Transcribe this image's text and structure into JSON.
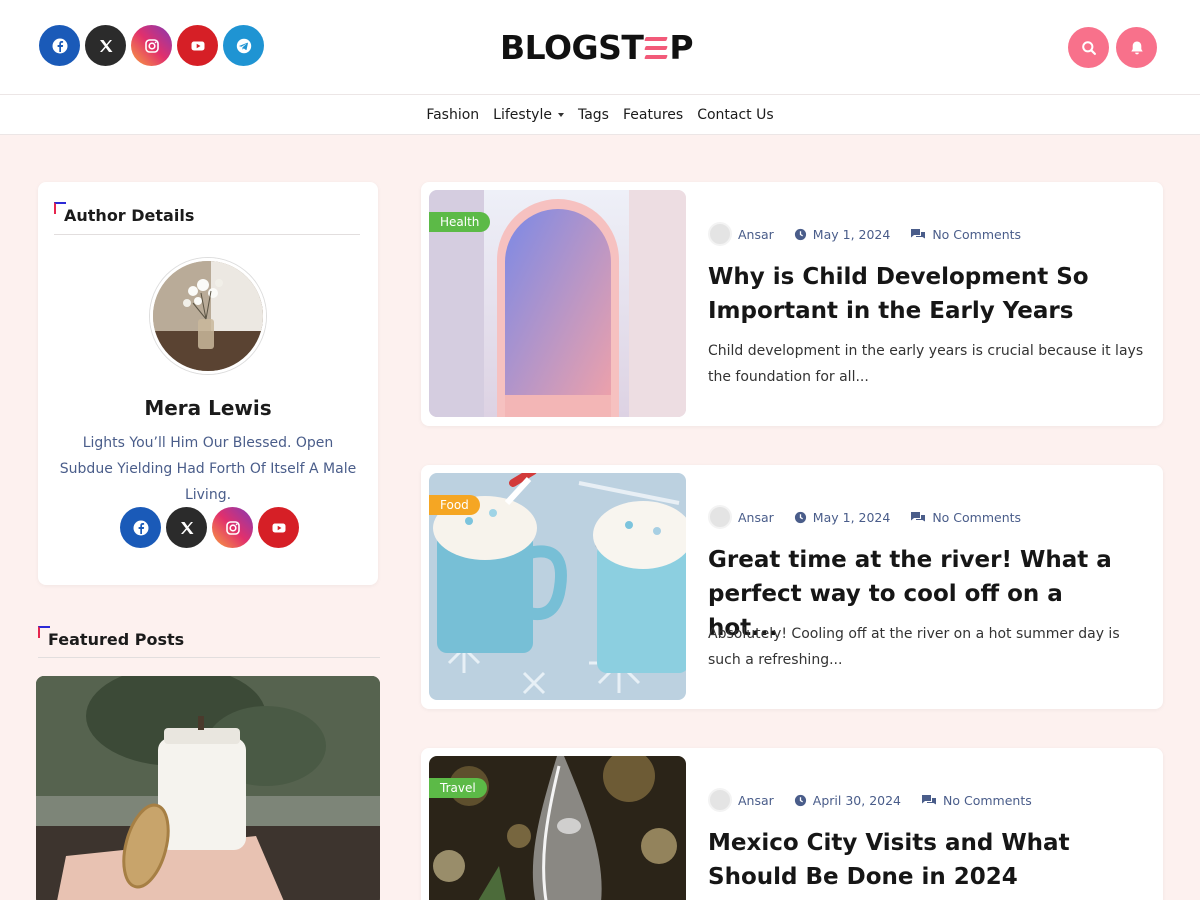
{
  "header": {
    "logo_text": "BLOGST",
    "logo_end": "P",
    "social": [
      {
        "icon": "facebook-icon",
        "color": "#1877f2"
      },
      {
        "icon": "x-icon",
        "color": "#222222"
      },
      {
        "icon": "instagram-icon",
        "color": "#d6249f"
      },
      {
        "icon": "youtube-icon",
        "color": "#e62117"
      },
      {
        "icon": "telegram-icon",
        "color": "#229ed9"
      }
    ],
    "accent": "#f8718b"
  },
  "nav": {
    "items": [
      {
        "label": "Fashion"
      },
      {
        "label": "Lifestyle",
        "dropdown": true
      },
      {
        "label": "Tags"
      },
      {
        "label": "Features"
      },
      {
        "label": "Contact Us"
      }
    ]
  },
  "sidebar": {
    "author_widget_title": "Author Details",
    "author_name": "Mera Lewis",
    "author_bio": "Lights You’ll Him Our Blessed. Open Subdue Yielding Had Forth Of Itself A Male Living.",
    "featured_title": "Featured Posts"
  },
  "posts": [
    {
      "category": "Health",
      "category_color": "#5cba47",
      "author": "Ansar",
      "date": "May 1, 2024",
      "comments": "No Comments",
      "title": "Why is Child Development So Important in the Early Years",
      "excerpt": "Child development in the early years is crucial because it lays the foundation for all..."
    },
    {
      "category": "Food",
      "category_color": "#f5a623",
      "author": "Ansar",
      "date": "May 1, 2024",
      "comments": "No Comments",
      "title": "Great time at the river! What a perfect way to cool off on a hot...",
      "excerpt": "Absolutely! Cooling off at the river on a hot summer day is such a refreshing..."
    },
    {
      "category": "Travel",
      "category_color": "#5cba47",
      "author": "Ansar",
      "date": "April 30, 2024",
      "comments": "No Comments",
      "title": "Mexico City Visits and What Should Be Done in 2024",
      "excerpt": ""
    }
  ]
}
